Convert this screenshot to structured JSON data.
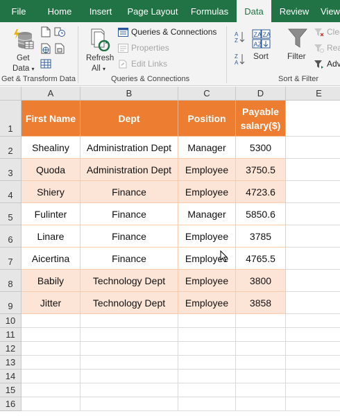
{
  "tabs": [
    {
      "label": "File",
      "active": false
    },
    {
      "label": "Home",
      "active": false
    },
    {
      "label": "Insert",
      "active": false
    },
    {
      "label": "Page Layout",
      "active": false
    },
    {
      "label": "Formulas",
      "active": false
    },
    {
      "label": "Data",
      "active": true
    },
    {
      "label": "Review",
      "active": false
    },
    {
      "label": "View",
      "active": false
    }
  ],
  "ribbon": {
    "get_data": {
      "line1": "Get",
      "line2": "Data"
    },
    "group_get_transform": "Get & Transform Data",
    "refresh_all": {
      "line1": "Refresh",
      "line2": "All"
    },
    "queries_connections": "Queries & Connections",
    "properties": "Properties",
    "edit_links": "Edit Links",
    "group_queries": "Queries & Connections",
    "sort": "Sort",
    "filter": "Filter",
    "clear": "Clear",
    "reapply": "Reapply",
    "advanced": "Advanced",
    "group_sort_filter": "Sort & Filter"
  },
  "columns": [
    "A",
    "B",
    "C",
    "D",
    "E"
  ],
  "header_row": [
    "First Name",
    "Dept",
    "Position",
    "Payable salary($)"
  ],
  "rows": [
    [
      "Shealiny",
      "Administration Dept",
      "Manager",
      "5300"
    ],
    [
      "Quoda",
      "Administration Dept",
      "Employee",
      "3750.5"
    ],
    [
      "Shiery",
      "Finance",
      "Employee",
      "4723.6"
    ],
    [
      "Fulinter",
      "Finance",
      "Manager",
      "5850.6"
    ],
    [
      "Linare",
      "Finance",
      "Employee",
      "3785"
    ],
    [
      "Aicertina",
      "Finance",
      "Employee",
      "4765.5"
    ],
    [
      "Babily",
      "Technology Dept",
      "Employee",
      "3800"
    ],
    [
      "Jitter",
      "Technology Dept",
      "Employee",
      "3858"
    ]
  ],
  "row_numbers": [
    "1",
    "2",
    "3",
    "4",
    "5",
    "6",
    "7",
    "8",
    "9",
    "10",
    "11",
    "12",
    "13",
    "14",
    "15",
    "16"
  ],
  "colors": {
    "tab_bar": "#217346",
    "header_fill": "#ed7d31",
    "tint_fill": "#fce4d6"
  }
}
